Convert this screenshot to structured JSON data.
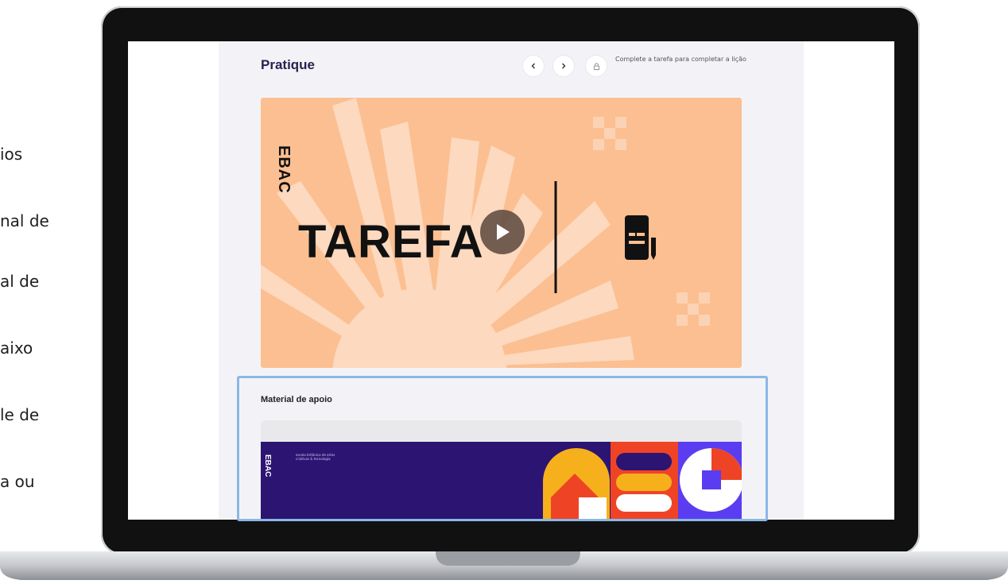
{
  "side_text": {
    "block1": [
      "ios",
      "nal de"
    ],
    "block2": [
      "al de",
      "aixo",
      "le de",
      "a ou"
    ]
  },
  "header": {
    "title": "Pratique",
    "prev_icon": "chevron-left-icon",
    "next_icon": "chevron-right-icon",
    "lock_icon": "lock-icon",
    "complete_text": "Complete a tarefa para completar a lição"
  },
  "video": {
    "title": "TAREFA",
    "logo_text": "EBAC",
    "play_icon": "play-icon",
    "document_icon": "document-pencil-icon",
    "bg_color": "#fbbf91"
  },
  "support": {
    "title": "Material de apoio",
    "banner_logo": "EBAC",
    "banner_text": "escola britânica de artes criativas & tecnologia",
    "banner_color": "#2c1473"
  },
  "highlight_color": "#8ab8e6"
}
